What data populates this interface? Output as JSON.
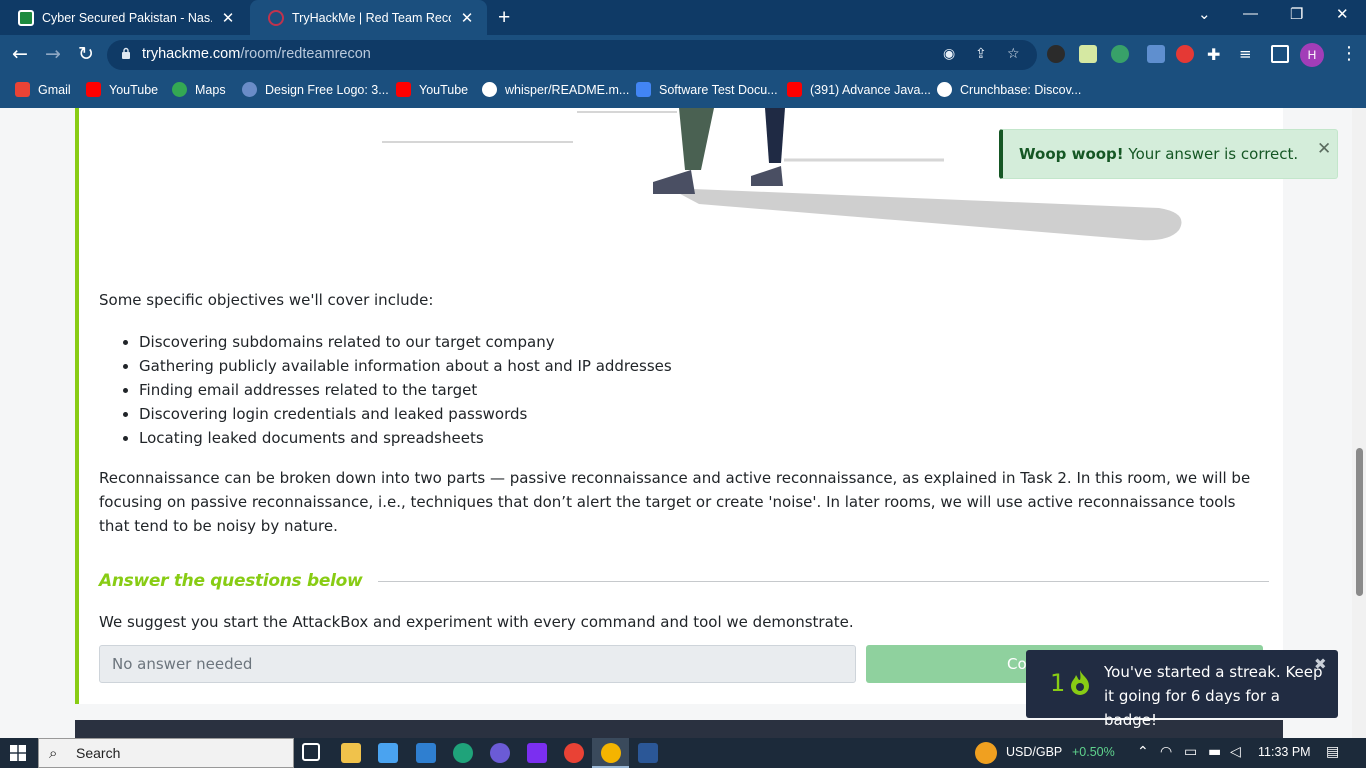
{
  "browser": {
    "tabs": [
      {
        "title": "Cyber Secured Pakistan - Nas.io I",
        "close": "✕",
        "favicon_color": "#1e8a3e"
      },
      {
        "title": "TryHackMe | Red Team Recon",
        "close": "✕",
        "favicon_color": "#c0334d"
      }
    ],
    "new_tab": "+",
    "window_controls": {
      "dropdown": "⌄",
      "minimize": "—",
      "restore": "❐",
      "close": "✕"
    },
    "url_domain": "tryhackme.com",
    "url_path": "/room/redteamrecon",
    "profile_initial": "H",
    "bookmarks": [
      {
        "label": "Gmail",
        "icon": "gmail-icon",
        "color": "#ea4335"
      },
      {
        "label": "YouTube",
        "icon": "youtube-icon",
        "color": "#ff0000"
      },
      {
        "label": "Maps",
        "icon": "maps-icon",
        "color": "#34a853"
      },
      {
        "label": "Design Free Logo: 3...",
        "icon": "design-logo-icon",
        "color": "#6a8cc7"
      },
      {
        "label": "YouTube",
        "icon": "youtube-icon",
        "color": "#ff0000"
      },
      {
        "label": "whisper/README.m...",
        "icon": "github-icon",
        "color": "#ffffff"
      },
      {
        "label": "Software Test Docu...",
        "icon": "docs-icon",
        "color": "#4285f4"
      },
      {
        "label": "(391) Advance Java...",
        "icon": "youtube-icon",
        "color": "#ff0000"
      },
      {
        "label": "Crunchbase: Discov...",
        "icon": "globe-icon",
        "color": "#ffffff"
      }
    ]
  },
  "room": {
    "intro": "Some specific objectives we'll cover include:",
    "objectives": [
      "Discovering subdomains related to our target company",
      "Gathering publicly available information about a host and IP addresses",
      "Finding email addresses related to the target",
      "Discovering login credentials and leaked passwords",
      "Locating leaked documents and spreadsheets"
    ],
    "paragraph": "Reconnaissance can be broken down into two parts — passive reconnaissance and active reconnaissance, as explained in Task 2. In this room, we will be focusing on passive reconnaissance, i.e., techniques that don’t alert the target or create 'noise'. In later rooms, we will use active reconnaissance tools that tend to be noisy by nature.",
    "answer_heading": "Answer the questions below",
    "question": "We suggest you start the AttackBox and experiment with every command and tool we demonstrate.",
    "answer_placeholder": "No answer needed",
    "submit_label": "Co",
    "accent_color": "#88cc14"
  },
  "toast": {
    "strong": "Woop woop!",
    "message": " Your answer is correct.",
    "close": "✕"
  },
  "streak": {
    "count": "1",
    "text": "You've started a streak. Keep it going for 6 days for a badge!",
    "close": "✖"
  },
  "taskbar": {
    "search_label": "Search",
    "currency_pair": "USD/GBP",
    "currency_change": "+0.50%",
    "time": "11:33 PM"
  }
}
